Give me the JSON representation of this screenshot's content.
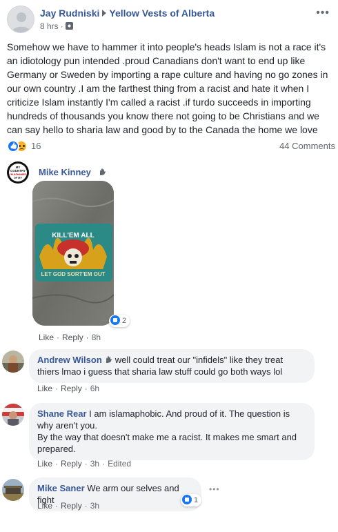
{
  "post": {
    "author": "Jay Rudniski",
    "group": "Yellow Vests of Alberta",
    "time": "8 hrs",
    "body": "Somehow we have to hammer it into people's heads Islam is not a race it's an idiotology pun intended .proud Canadians don't want to end up like Germany or Sweden by importing a rape culture and having no go zones in our own country .I am the farthest thing from a racist and hate it when I criticize Islam instantly I'm called a racist .if turdo succeeds in importing hundreds of thousands you know there not going to be Christians and we can say hello to sharia law and good by to the Canada the home we love",
    "reaction_count": "16",
    "comments_count": "44 Comments",
    "more_icon": "more-options-icon"
  },
  "comments": [
    {
      "name": "Mike Kinney",
      "text": "",
      "actions": {
        "like": "Like",
        "reply": "Reply",
        "time": "8h"
      },
      "image_caption_top": "KILL'EM ALL",
      "image_caption_bottom": "LET GOD SORT'EM OUT",
      "avatar_lines": [
        "MY",
        "COUNTRY",
        "I'M ASHAMED",
        "OF MY"
      ],
      "likes": "2"
    },
    {
      "name": "Andrew Wilson",
      "text": "well could treat our \"infidels\" like they treat thiers lmao i guess that sharia law stuff could go both ways lol",
      "actions": {
        "like": "Like",
        "reply": "Reply",
        "time": "6h"
      }
    },
    {
      "name": "Shane Rear",
      "text_line1": "I am islamaphobic. And proud of it. The question is why aren't you.",
      "text_line2": "By the way that doesn't make me a racist. It makes me smart and prepared.",
      "actions": {
        "like": "Like",
        "reply": "Reply",
        "time": "3h",
        "edited": "Edited"
      }
    },
    {
      "name": "Mike Saner",
      "text": "We arm our selves and fight",
      "actions": {
        "like": "Like",
        "reply": "Reply",
        "time": "3h"
      },
      "likes": "1"
    }
  ],
  "separators": {
    "dot": "·"
  },
  "colors": {
    "link": "#385898",
    "bubble": "#f2f3f5",
    "like_blue": "#1877f2",
    "meta": "#616770"
  }
}
